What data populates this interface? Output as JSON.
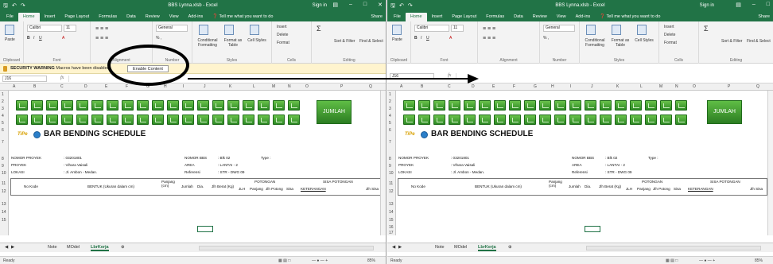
{
  "w1": {
    "title": "BBS Lynna.xlsb - Excel",
    "signin": "Sign in",
    "tabs": [
      "File",
      "Home",
      "Insert",
      "Page Layout",
      "Formulas",
      "Data",
      "Review",
      "View",
      "Add-ins",
      "❓ Tell me what you want to do"
    ],
    "share": "Share",
    "ribbon": {
      "font": "Calibri",
      "size": "11",
      "numfmt": "General",
      "paste": "Paste",
      "cond": "Conditional Formatting",
      "fmt_table": "Format as Table",
      "cell_styles": "Cell Styles",
      "insert": "Insert",
      "delete": "Delete",
      "format": "Format",
      "sort": "Sort & Filter",
      "find": "Find & Select",
      "groups": [
        "Clipboard",
        "Font",
        "Alignment",
        "Number",
        "Styles",
        "Cells",
        "Editing"
      ]
    },
    "security": {
      "label": "SECURITY WARNING",
      "text": "Macros have been disabled.",
      "button": "Enable Content"
    },
    "namebox": "J16",
    "cols": [
      "A",
      "B",
      "C",
      "D",
      "E",
      "F",
      "G",
      "H",
      "I",
      "J",
      "K",
      "L",
      "M",
      "N",
      "O",
      "P",
      "Q"
    ],
    "rows": [
      "1",
      "2",
      "3",
      "4",
      "5",
      "6",
      "7",
      "8",
      "9",
      "10",
      "11",
      "12",
      "13",
      "14",
      "15"
    ],
    "jumlah": "JUMLAH",
    "logo": "TiPe",
    "heading": "BAR BENDING SCHEDULE",
    "info": [
      [
        "NOMOR PROYEK",
        ": 03201801"
      ],
      [
        "PROYEK",
        ": Vihara Vaisali"
      ],
      [
        "LOKASI",
        ": Jl. Ambon - Medan."
      ]
    ],
    "info_r": [
      [
        "NOMOR BBS",
        ": Blk 02"
      ],
      [
        "AREA",
        ": LANTAI - 2"
      ],
      [
        "Referensi",
        ": STR - DWG 09"
      ]
    ],
    "type": "Type :",
    "hdr": {
      "kode": "No Kode",
      "bentuk": "BENTUK (Ukuran dalam cm)",
      "panjang": "Panjang (cm)",
      "jumlah": "Jumlah",
      "dia": "Dia.",
      "berat": "Jlh Berat (Kg)",
      "potongan": "POTONGAN",
      "jlh": "JLH",
      "panjang2": "Panjang",
      "jlhpot": "Jlh Potong",
      "sisa": "Sisa",
      "sisapot": "SISA POTONGAN",
      "ket": "KETERANGAN",
      "jlhsisa": "Jlh Sisa"
    },
    "sheets": [
      "Note",
      "MOdel",
      "LbrKerja"
    ],
    "status": "Ready",
    "zoom": "85%"
  },
  "w2": {
    "title": "BBS Lynna.xlsb - Excel",
    "signin": "Sign in",
    "tabs": [
      "File",
      "Home",
      "Insert",
      "Page Layout",
      "Formulas",
      "Data",
      "Review",
      "View",
      "Add-ins",
      "❓ Tell me what you want to do"
    ],
    "share": "Share",
    "ribbon": {
      "font": "Calibri",
      "size": "11",
      "numfmt": "General",
      "paste": "Paste",
      "cond": "Conditional Formatting",
      "fmt_table": "Format as Table",
      "cell_styles": "Cell Styles",
      "insert": "Insert",
      "delete": "Delete",
      "format": "Format",
      "sort": "Sort & Filter",
      "find": "Find & Select",
      "groups": [
        "Clipboard",
        "Font",
        "Alignment",
        "Number",
        "Styles",
        "Cells",
        "Editing"
      ]
    },
    "namebox": "J16",
    "cols": [
      "A",
      "B",
      "C",
      "D",
      "E",
      "F",
      "G",
      "H",
      "I",
      "J",
      "K",
      "L",
      "M",
      "N",
      "O",
      "P",
      "Q"
    ],
    "rows": [
      "1",
      "2",
      "3",
      "4",
      "5",
      "6",
      "7",
      "8",
      "9",
      "10",
      "11",
      "12",
      "13",
      "14",
      "15",
      "16",
      "17"
    ],
    "jumlah": "JUMLAH",
    "logo": "TiPe",
    "heading": "BAR BENDING SCHEDULE",
    "info": [
      [
        "NOMOR PROYEK",
        ": 03201801"
      ],
      [
        "PROYEK",
        ": Vihara Vaisali"
      ],
      [
        "LOKASI",
        ": Jl. Ambon - Medan."
      ]
    ],
    "info_r": [
      [
        "NOMOR BBS",
        ": Blk 02"
      ],
      [
        "AREA",
        ": LANTAI - 2"
      ],
      [
        "Referensi",
        ": STR - DWG 09"
      ]
    ],
    "type": "Type :",
    "hdr": {
      "kode": "No Kode",
      "bentuk": "BENTUK (Ukuran dalam cm)",
      "panjang": "Panjang (cm)",
      "jumlah": "Jumlah",
      "dia": "Dia.",
      "berat": "Jlh Berat (Kg)",
      "potongan": "POTONGAN",
      "jlh": "JLH",
      "panjang2": "Panjang",
      "jlhpot": "Jlh Potong",
      "sisa": "Sisa",
      "sisapot": "SISA POTONGAN",
      "ket": "KETERANGAN",
      "jlhsisa": "Jlh Sisa"
    },
    "sheets": [
      "Note",
      "MOdel",
      "LbrKerja"
    ],
    "status": "Ready",
    "zoom": "85%"
  },
  "colors": {
    "excel_green": "#217346",
    "warning_bg": "#fff4ce",
    "button_green": "#3fa12f"
  }
}
